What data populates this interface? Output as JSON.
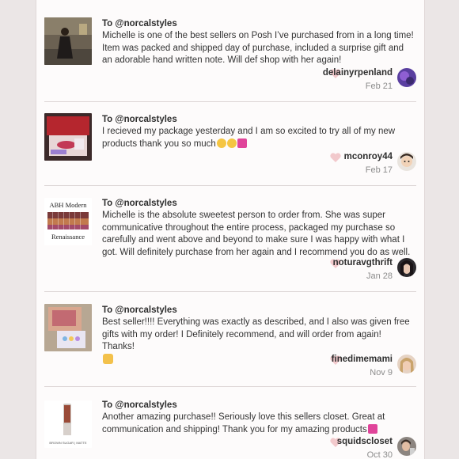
{
  "reviews": [
    {
      "to": "To @norcalstyles",
      "message": "Michelle is one of the best sellers on Posh I’ve purchased from in a long time! Item was packed and shipped day of purchase, included a surprise gift and an adorable hand written note. Will def shop with her again!",
      "username": "delainyrpenland",
      "date": "Feb 21",
      "thumb_icon": "dark-outfit-photo",
      "avatar_icon": "purple-avatar"
    },
    {
      "to": "To @norcalstyles",
      "message": "I recieved my package yesterday and I am so excited to try all of my new products thank you so much",
      "emojis": [
        "blush-emoji",
        "blush-emoji",
        "sparkling-heart-emoji"
      ],
      "username": "mconroy44",
      "date": "Feb 17",
      "thumb_icon": "makeup-box-photo",
      "avatar_icon": "cartoon-avatar"
    },
    {
      "to": "To @norcalstyles",
      "message": "Michelle is the absolute sweetest person to order from. She was super communicative throughout the entire process, packaged my purchase so carefully and went above and beyond to make sure I was happy with what I got. Will definitely purchase from her again and I recommend you do as well.",
      "username": "noturavgthrift",
      "date": "Jan 28",
      "thumb_icon": "palette-photo",
      "thumb_text_top": "ABH Modern",
      "thumb_text_bottom": "Renaissance",
      "avatar_icon": "dark-hair-avatar"
    },
    {
      "to": "To @norcalstyles",
      "message": "Best seller!!!! Everything was exactly as described, and I also was given free gifts with my order! I Definitely recommend, and will order from again! Thanks!",
      "emojis": [
        "clapping-hands-emoji"
      ],
      "username": "finedimemami",
      "date": "Nov 9",
      "thumb_icon": "palette-package-photo",
      "avatar_icon": "blonde-avatar"
    },
    {
      "to": "To @norcalstyles",
      "message": "Another amazing purchase!! Seriously love this sellers closet. Great at communication and shipping! Thank you for my amazing products",
      "emojis": [
        "sparkling-heart-emoji"
      ],
      "username": "squidscloset",
      "date": "Oct 30",
      "thumb_icon": "lipstick-photo",
      "thumb_caption": "BROWN SUGAR | MATTE",
      "avatar_icon": "selfie-avatar"
    }
  ],
  "colors": {
    "heart": "#f2c9cc",
    "page_bg": "#fdfbfb",
    "outer_bg": "#ebe6e6"
  }
}
